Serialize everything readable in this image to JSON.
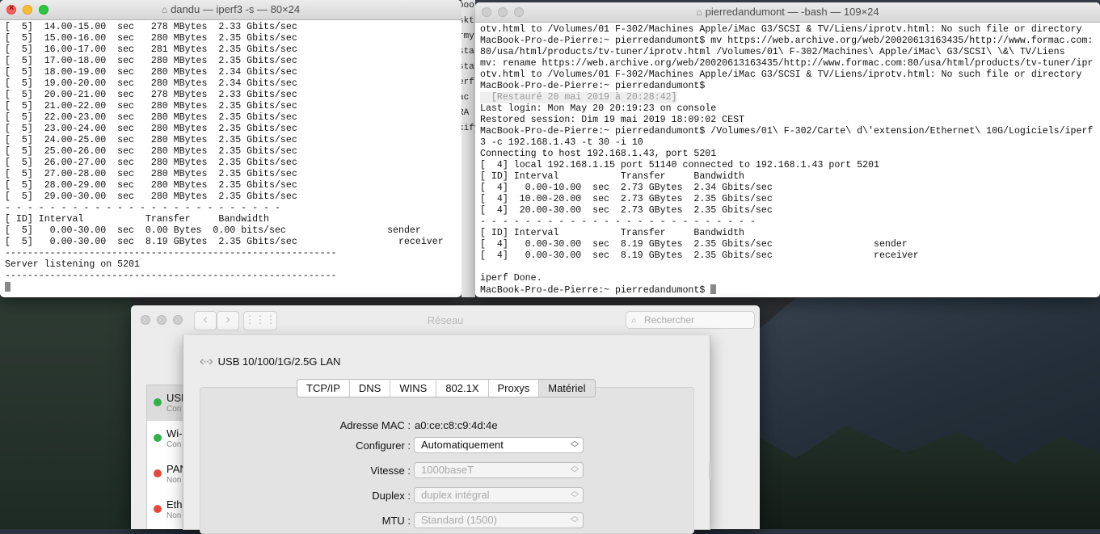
{
  "desktop": {
    "wallpaper": "mountain-dusk"
  },
  "terminal_left": {
    "title": "dandu — iperf3 -s — 80×24",
    "lines": [
      "[  5]  14.00-15.00  sec   278 MBytes  2.33 Gbits/sec",
      "[  5]  15.00-16.00  sec   280 MBytes  2.35 Gbits/sec",
      "[  5]  16.00-17.00  sec   281 MBytes  2.35 Gbits/sec",
      "[  5]  17.00-18.00  sec   280 MBytes  2.35 Gbits/sec",
      "[  5]  18.00-19.00  sec   280 MBytes  2.34 Gbits/sec",
      "[  5]  19.00-20.00  sec   280 MBytes  2.34 Gbits/sec",
      "[  5]  20.00-21.00  sec   278 MBytes  2.33 Gbits/sec",
      "[  5]  21.00-22.00  sec   280 MBytes  2.35 Gbits/sec",
      "[  5]  22.00-23.00  sec   280 MBytes  2.35 Gbits/sec",
      "[  5]  23.00-24.00  sec   280 MBytes  2.35 Gbits/sec",
      "[  5]  24.00-25.00  sec   280 MBytes  2.35 Gbits/sec",
      "[  5]  25.00-26.00  sec   280 MBytes  2.35 Gbits/sec",
      "[  5]  26.00-27.00  sec   280 MBytes  2.35 Gbits/sec",
      "[  5]  27.00-28.00  sec   280 MBytes  2.35 Gbits/sec",
      "[  5]  28.00-29.00  sec   280 MBytes  2.35 Gbits/sec",
      "[  5]  29.00-30.00  sec   280 MBytes  2.35 Gbits/sec",
      "- - - - - - - - - - - - - - - - - - - - - - - - -",
      "[ ID] Interval           Transfer     Bandwidth",
      "[  5]   0.00-30.00  sec  0.00 Bytes  0.00 bits/sec                  sender",
      "[  5]   0.00-30.00  sec  8.19 GBytes  2.35 Gbits/sec                  receiver",
      "-----------------------------------------------------------",
      "Server listening on 5201",
      "-----------------------------------------------------------"
    ]
  },
  "strip_text": [
    "boot",
    "skt",
    "rmy",
    "sta",
    "sta",
    "erf",
    "ac",
    "RA",
    "kify"
  ],
  "terminal_right": {
    "title": "pierredandumont — -bash — 109×24",
    "lines_before": [
      "otv.html to /Volumes/01 F-302/Machines Apple/iMac G3/SCSI & TV/Liens/iprotv.html: No such file or directory",
      "MacBook-Pro-de-Pierre:~ pierredandumont$ mv https://web.archive.org/web/20020613163435/http://www.formac.com:",
      "80/usa/html/products/tv-tuner/iprotv.html /Volumes/01\\ F-302/Machines\\ Apple/iMac\\ G3/SCSI\\ \\&\\ TV/Liens",
      "mv: rename https://web.archive.org/web/20020613163435/http://www.formac.com:80/usa/html/products/tv-tuner/ipr",
      "otv.html to /Volumes/01 F-302/Machines Apple/iMac G3/SCSI & TV/Liens/iprotv.html: No such file or directory",
      "MacBook-Pro-de-Pierre:~ pierredandumont$"
    ],
    "restored_banner": "  [Restauré 20 mai 2019 à 20:28:42]",
    "lines_after": [
      "Last login: Mon May 20 20:19:23 on console",
      "Restored session: Dim 19 mai 2019 18:09:02 CEST",
      "MacBook-Pro-de-Pierre:~ pierredandumont$ /Volumes/01\\ F-302/Carte\\ d\\'extension/Ethernet\\ 10G/Logiciels/iperf",
      "3 -c 192.168.1.43 -t 30 -i 10",
      "Connecting to host 192.168.1.43, port 5201",
      "[  4] local 192.168.1.15 port 51140 connected to 192.168.1.43 port 5201",
      "[ ID] Interval           Transfer     Bandwidth",
      "[  4]   0.00-10.00  sec  2.73 GBytes  2.34 Gbits/sec",
      "[  4]  10.00-20.00  sec  2.73 GBytes  2.35 Gbits/sec",
      "[  4]  20.00-30.00  sec  2.73 GBytes  2.35 Gbits/sec",
      "- - - - - - - - - - - - - - - - - - - - - - - - -",
      "[ ID] Interval           Transfer     Bandwidth",
      "[  4]   0.00-30.00  sec  8.19 GBytes  2.35 Gbits/sec                  sender",
      "[  4]   0.00-30.00  sec  8.19 GBytes  2.35 Gbits/sec                  receiver",
      "",
      "iperf Done."
    ],
    "prompt": "MacBook-Pro-de-Pierre:~ pierredandumont$ "
  },
  "prefs": {
    "title": "Réseau",
    "search_placeholder": "Rechercher",
    "services": [
      {
        "name": "USB",
        "status": "Con",
        "color": "#2fb14a"
      },
      {
        "name": "Wi-",
        "status": "Con",
        "color": "#2fb14a"
      },
      {
        "name": "PAN",
        "status": "Non",
        "color": "#e24a3c"
      },
      {
        "name": "Ethe",
        "status": "Non",
        "color": "#e24a3c"
      }
    ]
  },
  "sheet": {
    "interface_name": "USB 10/100/1G/2.5G LAN",
    "tabs": [
      "TCP/IP",
      "DNS",
      "WINS",
      "802.1X",
      "Proxys",
      "Matériel"
    ],
    "active_tab": "Matériel",
    "mac_label": "Adresse MAC :",
    "mac_value": "a0:ce:c8:c9:4d:4e",
    "configure_label": "Configurer :",
    "configure_value": "Automatiquement",
    "speed_label": "Vitesse :",
    "speed_value": "1000baseT",
    "duplex_label": "Duplex :",
    "duplex_value": "duplex intégral",
    "mtu_label": "MTU :",
    "mtu_value": "Standard  (1500)"
  }
}
